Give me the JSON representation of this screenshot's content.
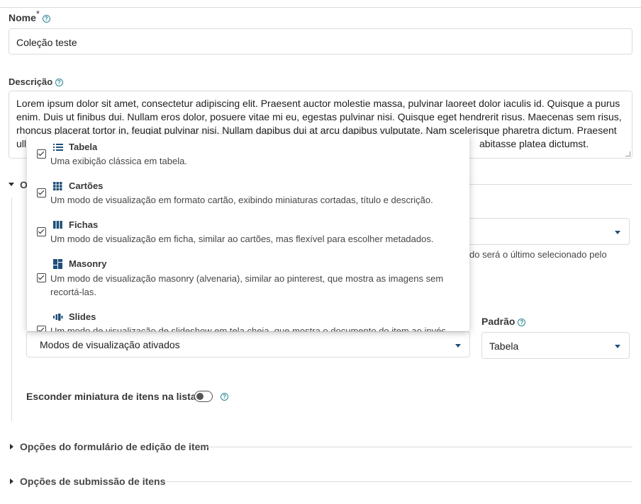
{
  "form": {
    "name": {
      "label": "Nome",
      "required_mark": "*",
      "value": "Coleção teste"
    },
    "description": {
      "label": "Descrição",
      "lines": [
        "Lorem ipsum dolor sit amet, consectetur adipiscing elit. Praesent auctor molestie massa, pulvinar laoreet dolor iaculis id. Quisque a purus",
        "enim. Duis ut finibus dui. Nullam eros dolor, posuere vitae mi eu, egestas pulvinar nisi. Quisque eget hendrerit risus. Maecenas sem risus,",
        "rhoncus placerat tortor in, feugiat pulvinar nisi. Nullam dapibus dui at arcu dapibus vulputate. Nam scelerisque pharetra dictum. Praesent",
        "ull",
        "abitasse platea dictumst."
      ]
    },
    "collapsed_section_initial": "O",
    "hidden_hint": "do será o último selecionado pelo",
    "view_modes": {
      "select_label": "Modos de visualização ativados",
      "options": [
        {
          "title": "Tabela",
          "icon": "list-icon",
          "checked": true,
          "desc": [
            "Uma exibição clássica em tabela."
          ]
        },
        {
          "title": "Cartões",
          "icon": "grid-icon",
          "checked": true,
          "desc": [
            "Um modo de visualização em formato cartão, exibindo miniaturas cortadas, título e descrição."
          ]
        },
        {
          "title": "Fichas",
          "icon": "columns-icon",
          "checked": true,
          "desc": [
            "Um modo de visualização em ficha, similar ao cartões, mas flexível para escolher metadados."
          ]
        },
        {
          "title": "Masonry",
          "icon": "masonry-icon",
          "checked": true,
          "desc": [
            "Um modo de visualização masonry (alvenaria), similar ao pinterest, que mostra as imagens sem",
            "recortá-las."
          ]
        },
        {
          "title": "Slides",
          "icon": "slides-icon",
          "checked": true,
          "desc": [
            "Um modo de visualização de slideshow em tela cheia, que mostra o documento do item ao invés"
          ]
        }
      ]
    },
    "default_view": {
      "label": "Padrão",
      "value": "Tabela"
    },
    "hide_thumbnail": {
      "label": "Esconder miniatura de itens na lista",
      "on": false
    },
    "sections": [
      {
        "title": "Opções do formulário de edição de item"
      },
      {
        "title": "Opções de submissão de itens"
      }
    ]
  }
}
